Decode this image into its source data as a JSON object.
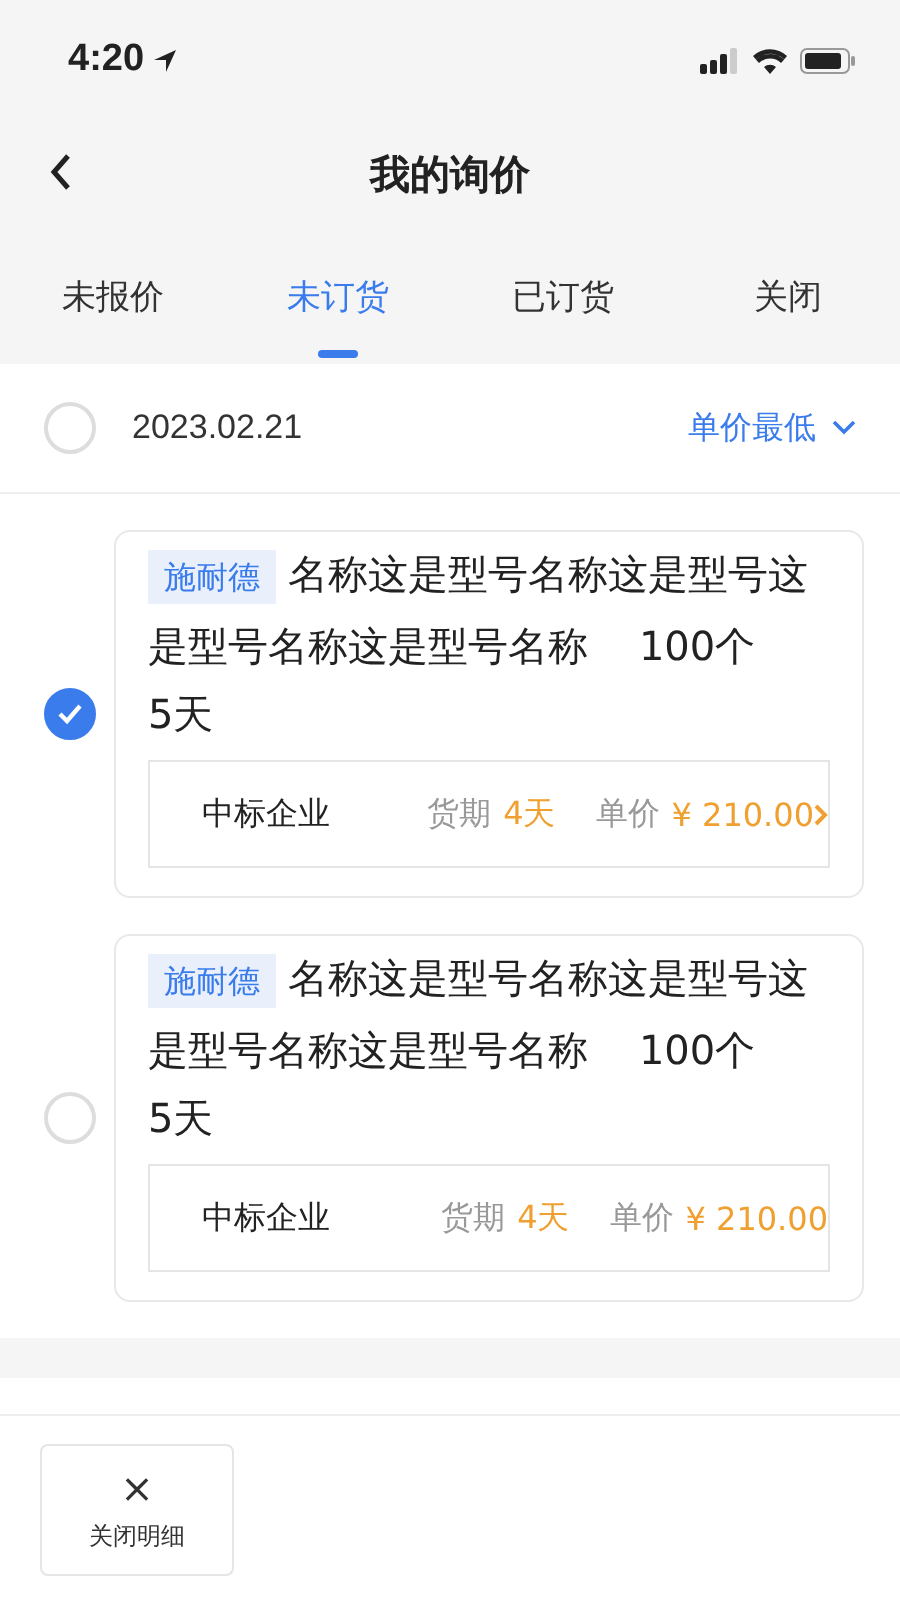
{
  "status_bar": {
    "time": "4:20"
  },
  "nav": {
    "title": "我的询价"
  },
  "tabs": [
    {
      "label": "未报价",
      "selected": false
    },
    {
      "label": "未订货",
      "selected": true
    },
    {
      "label": "已订货",
      "selected": false
    },
    {
      "label": "关闭",
      "selected": false
    }
  ],
  "group": {
    "date": "2023.02.21",
    "checked": false,
    "sort": "单价最低"
  },
  "items": [
    {
      "brand": "施耐德",
      "name": "名称这是型号名称这是型号这是型号名称这是型号名称",
      "quantity": "100个",
      "days": "5天",
      "checked": true,
      "supplier": "中标企业",
      "delivery_label": "货期",
      "delivery": "4天",
      "price_label": "单价",
      "price": "¥ 210.00",
      "arrow": true
    },
    {
      "brand": "施耐德",
      "name": "名称这是型号名称这是型号这是型号名称这是型号名称",
      "quantity": "100个",
      "days": "5天",
      "checked": false,
      "supplier": "中标企业",
      "delivery_label": "货期",
      "delivery": "4天",
      "price_label": "单价",
      "price": "¥ 210.00",
      "arrow": false
    }
  ],
  "bottom_bar": {
    "buttons": [
      {
        "icon": "×",
        "label": "关闭明细"
      }
    ]
  }
}
